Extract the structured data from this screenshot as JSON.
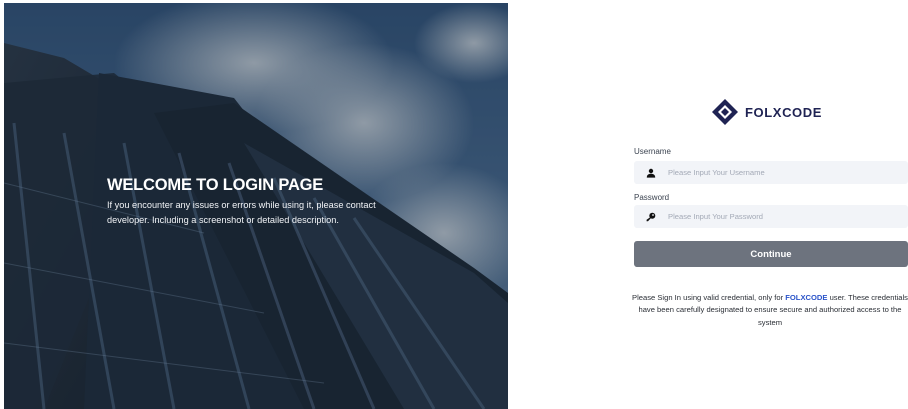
{
  "hero": {
    "title": "WELCOME TO LOGIN PAGE",
    "description": "If you encounter any issues or errors while using it, please contact developer. Including a screenshot or detailed description."
  },
  "brand": {
    "name": "FOLXCODE",
    "color": "#1f2353"
  },
  "form": {
    "username_label": "Username",
    "username_placeholder": "Please Input Your Username",
    "username_value": "",
    "password_label": "Password",
    "password_placeholder": "Please Input Your Password",
    "password_value": "",
    "username_icon": "user-icon",
    "password_icon": "key-icon",
    "continue_label": "Continue",
    "continue_color": "#6d737e"
  },
  "note": {
    "before": "Please Sign In using valid credential, only for ",
    "highlight": "FOLXCODE",
    "after": " user. These credentials have been carefully designated to ensure secure and authorized access to the system",
    "highlight_color": "#2b54c9"
  }
}
